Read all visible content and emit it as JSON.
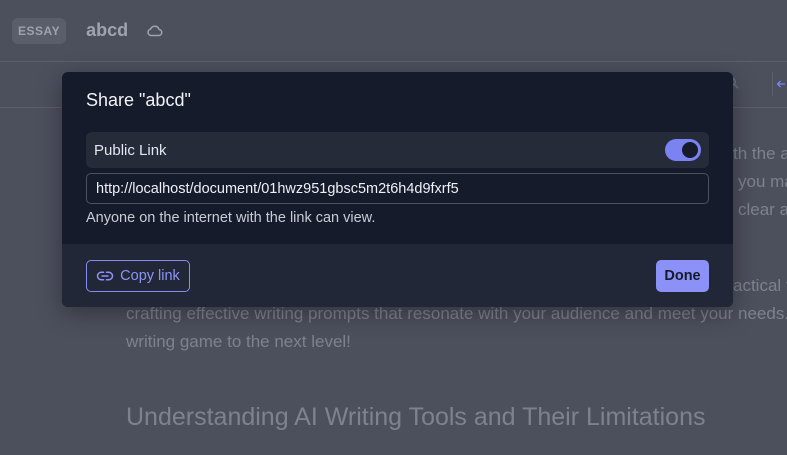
{
  "app": {
    "badge": "ESSAY",
    "doc_title": "abcd"
  },
  "background": {
    "para1_fragments": [
      "th the a",
      "you ma",
      "clear a"
    ],
    "para2_line1": "actical t",
    "para2_line2": "crafting effective writing prompts that resonate with your audience and meet your needs. Ge",
    "para2_line3": "writing game to the next level!",
    "heading": "Understanding AI Writing Tools and Their Limitations"
  },
  "modal": {
    "title": "Share \"abcd\"",
    "public_link_label": "Public Link",
    "public_link_enabled": true,
    "link_value": "http://localhost/document/01hwz951gbsc5m2t6h4d9fxrf5",
    "hint": "Anyone on the internet with the link can view.",
    "copy_label": "Copy link",
    "done_label": "Done"
  },
  "colors": {
    "accent": "#8b91f6",
    "modal_bg": "#161b2b",
    "overlay_bg": "#4c505d"
  },
  "icons": [
    "cloud-icon",
    "link-icon",
    "search-icon",
    "back-arrow-icon"
  ]
}
